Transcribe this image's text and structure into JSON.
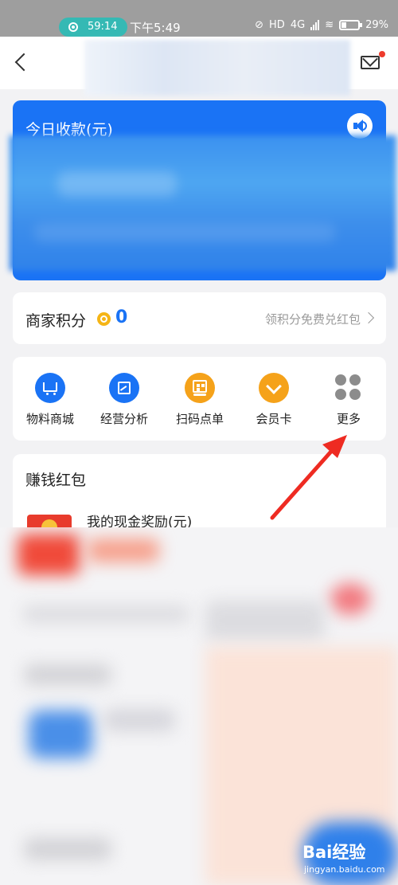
{
  "status_bar": {
    "record_time": "59:14",
    "clock": "下午5:49",
    "hd_label": "HD",
    "net_label": "4G",
    "battery": "29%"
  },
  "header": {
    "back_icon": "chevron-left-icon",
    "mail_icon": "mail-icon"
  },
  "today_card": {
    "title": "今日收款(元)",
    "speaker_icon": "speaker-icon",
    "accent": "#1a73f5"
  },
  "points": {
    "label": "商家积分",
    "value": "0",
    "promo": "领积分免费兑红包",
    "value_color": "#1a73f5"
  },
  "quick_actions": [
    {
      "label": "物料商城",
      "icon": "cart-icon"
    },
    {
      "label": "经营分析",
      "icon": "chart-icon"
    },
    {
      "label": "扫码点单",
      "icon": "qr-order-icon"
    },
    {
      "label": "会员卡",
      "icon": "member-card-icon"
    },
    {
      "label": "更多",
      "icon": "more-grid-icon"
    }
  ],
  "earn_section": {
    "title": "赚钱红包",
    "reward_label": "我的现金奖励(元)"
  },
  "annotation": {
    "arrow_color": "#ee2b22"
  },
  "watermark": {
    "text": "Bai经验",
    "url": "jingyan.baidu.com"
  }
}
